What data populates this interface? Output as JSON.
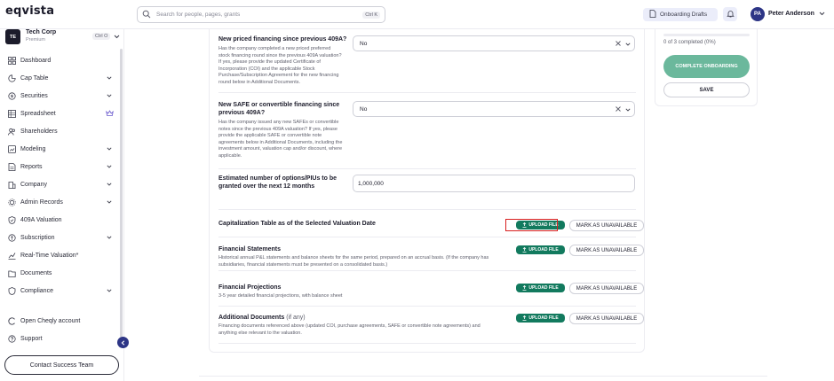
{
  "app": {
    "logo": "eqvista"
  },
  "search": {
    "placeholder": "Search for people, pages, grants",
    "shortcut": "Ctrl K"
  },
  "header": {
    "drafts_label": "Onboarding Drafts",
    "user_initials": "PA",
    "user_name": "Peter Anderson"
  },
  "company": {
    "initials": "TE",
    "name": "Tech Corp",
    "plan": "Premium",
    "shortcut": "Ctrl O"
  },
  "sidebar": {
    "items": [
      {
        "label": "Dashboard",
        "icon": "dashboard-icon",
        "has_chevron": false
      },
      {
        "label": "Cap Table",
        "icon": "cap-table-icon",
        "has_chevron": true
      },
      {
        "label": "Securities",
        "icon": "securities-icon",
        "has_chevron": true
      },
      {
        "label": "Spreadsheet",
        "icon": "spreadsheet-icon",
        "has_chevron": false,
        "premium": true
      },
      {
        "label": "Shareholders",
        "icon": "shareholders-icon",
        "has_chevron": false
      },
      {
        "label": "Modeling",
        "icon": "modeling-icon",
        "has_chevron": true
      },
      {
        "label": "Reports",
        "icon": "reports-icon",
        "has_chevron": true
      },
      {
        "label": "Company",
        "icon": "company-icon",
        "has_chevron": true
      },
      {
        "label": "Admin Records",
        "icon": "admin-records-icon",
        "has_chevron": true
      },
      {
        "label": "409A Valuation",
        "icon": "valuation-icon",
        "has_chevron": false
      },
      {
        "label": "Subscription",
        "icon": "subscription-icon",
        "has_chevron": true
      },
      {
        "label": "Real-Time Valuation*",
        "icon": "realtime-valuation-icon",
        "has_chevron": false
      },
      {
        "label": "Documents",
        "icon": "documents-icon",
        "has_chevron": false
      },
      {
        "label": "Compliance",
        "icon": "compliance-icon",
        "has_chevron": true
      },
      {
        "label": "Open Cheqly account",
        "icon": "cheqly-icon",
        "has_chevron": false
      },
      {
        "label": "Support",
        "icon": "support-icon",
        "has_chevron": false
      }
    ],
    "contact_label": "Contact Success Team"
  },
  "form": {
    "priced_financing": {
      "title": "New priced financing since previous 409A?",
      "description": "Has the company completed a new priced preferred stock financing round since the previous 409A valuation? If yes, please provide the updated Certificate of Incorporation (COI) and the applicable Stock Purchase/Subscription Agreement for the new financing round below in Additional Documents.",
      "value": "No"
    },
    "safe_financing": {
      "title": "New SAFE or convertible financing since previous 409A?",
      "description": "Has the company issued any new SAFEs or convertible notes since the previous 409A valuation? If yes, please provide the applicable SAFE or convertible note agreements below in Additional Documents, including the investment amount, valuation cap and/or discount, where applicable.",
      "value": "No"
    },
    "options_estimate": {
      "title": "Estimated number of options/PIUs to be granted over the next 12 months",
      "value": "1,000,000"
    },
    "uploads": [
      {
        "title": "Capitalization Table as of the Selected Valuation Date",
        "optional": "",
        "description": ""
      },
      {
        "title": "Financial Statements",
        "optional": "",
        "description": "Historical annual P&L statements and balance sheets for the same period, prepared on an accrual basis. (If the company has subsidiaries, financial statements must be presented on a consolidated basis.)"
      },
      {
        "title": "Financial Projections",
        "optional": "",
        "description": "3-5 year detailed financial projections, with balance sheet"
      },
      {
        "title": "Additional Documents",
        "optional": "(if any)",
        "description": "Financing documents referenced above (updated COI, purchase agreements, SAFE or convertible note agreements) and anything else relevant to the valuation."
      }
    ],
    "upload_label": "UPLOAD FILE",
    "unavailable_label": "MARK AS UNAVAILABLE"
  },
  "progress": {
    "text": "0 of 3 completed (0%)",
    "percent": 0,
    "complete_label": "COMPLETE ONBOARDING",
    "save_label": "SAVE"
  },
  "colors": {
    "brand_navy": "#2d3586",
    "upload_green": "#127a5e",
    "complete_green": "#6bb89c",
    "highlight_red": "#d81e1e"
  }
}
